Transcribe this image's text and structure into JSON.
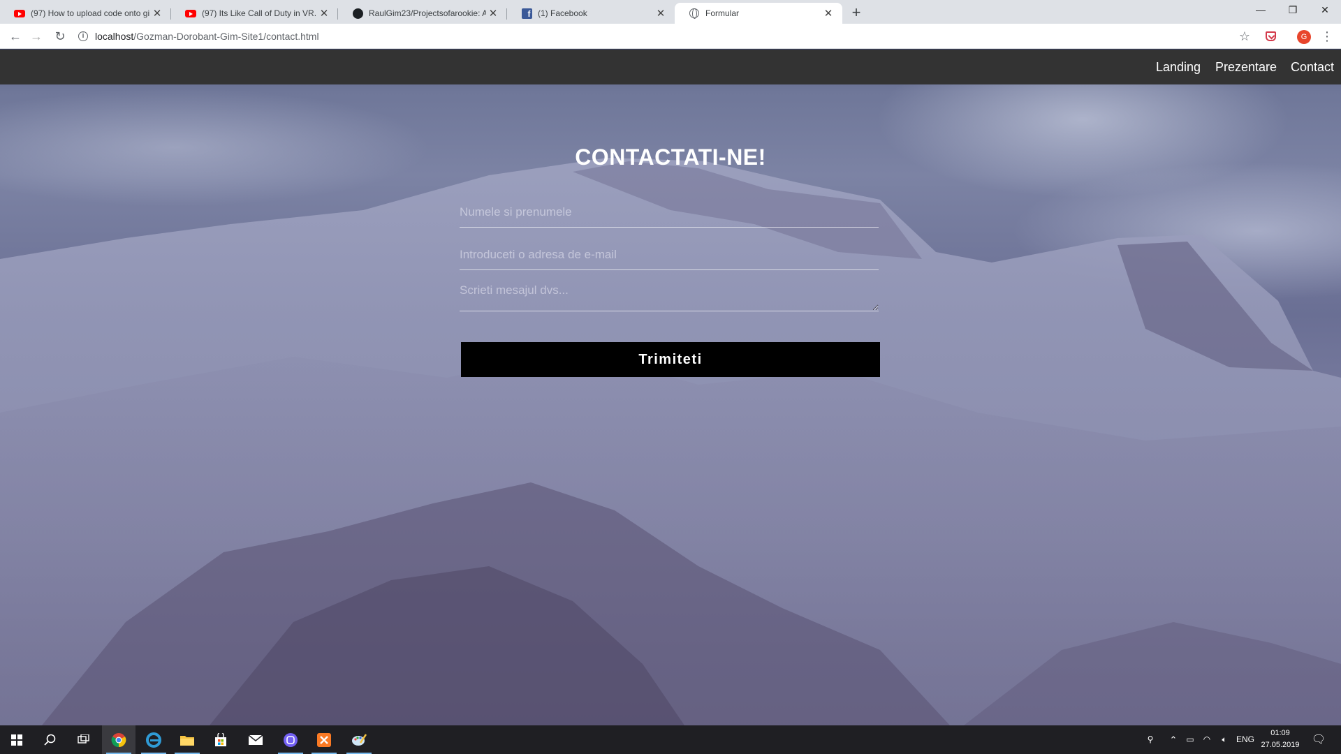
{
  "browser": {
    "tabs": [
      {
        "title": "(97) How to upload code onto gi",
        "icon": "youtube-icon",
        "active": false
      },
      {
        "title": "(97) Its Like Call of Duty in VR.",
        "icon": "youtube-icon",
        "active": false
      },
      {
        "title": "RaulGim23/Projectsofarookie: A",
        "icon": "github-icon",
        "active": false
      },
      {
        "title": "(1) Facebook",
        "icon": "facebook-icon",
        "active": false
      },
      {
        "title": "Formular",
        "icon": "globe-icon",
        "active": true
      }
    ],
    "new_tab_glyph": "+",
    "window_controls": {
      "minimize": "—",
      "restore": "❐",
      "close": "✕"
    },
    "url_host": "localhost",
    "url_path": "/Gozman-Dorobant-Gim-Site1/contact.html",
    "profile_initial": "G"
  },
  "site": {
    "nav": [
      "Landing",
      "Prezentare",
      "Contact"
    ],
    "heading": "CONTACTATI-NE!",
    "form": {
      "name_placeholder": "Numele si prenumele",
      "email_placeholder": "Introduceti o adresa de e-mail",
      "message_placeholder": "Scrieti mesajul dvs...",
      "submit_label": "Trimiteti"
    },
    "colors": {
      "nav_bg": "#333333",
      "button_bg": "#000000",
      "text": "#ffffff"
    }
  },
  "taskbar": {
    "apps": [
      "windows-start-icon",
      "search-icon",
      "task-view-icon",
      "chrome-icon",
      "edge-icon",
      "file-explorer-icon",
      "store-icon",
      "mail-icon",
      "viber-icon",
      "xampp-icon",
      "paint-icon"
    ],
    "language": "ENG",
    "time": "01:09",
    "date": "27.05.2019"
  }
}
